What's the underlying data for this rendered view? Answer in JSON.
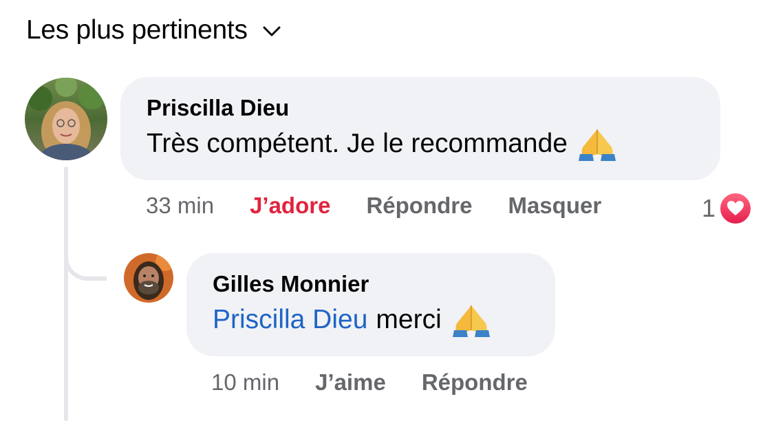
{
  "sort": {
    "label": "Les plus pertinents",
    "icon": "chevron-down-icon"
  },
  "comments": [
    {
      "author": "Priscilla Dieu",
      "text": "Très compétent. Je le recommande",
      "emoji": "folded-hands-icon",
      "time": "33 min",
      "reaction_action": "J’adore",
      "reaction_action_color": "#e0243d",
      "reply_label": "Répondre",
      "hide_label": "Masquer",
      "reaction_count": "1",
      "reaction_type": "heart-icon"
    },
    {
      "author": "Gilles Monnier",
      "mention": "Priscilla Dieu",
      "text": "merci",
      "emoji": "folded-hands-icon",
      "time": "10 min",
      "like_label": "J’aime",
      "reply_label": "Répondre"
    }
  ],
  "colors": {
    "bubble": "#f0f2f5",
    "secondary_text": "#65676b",
    "mention": "#1f63c6",
    "love": "#e0243d"
  }
}
